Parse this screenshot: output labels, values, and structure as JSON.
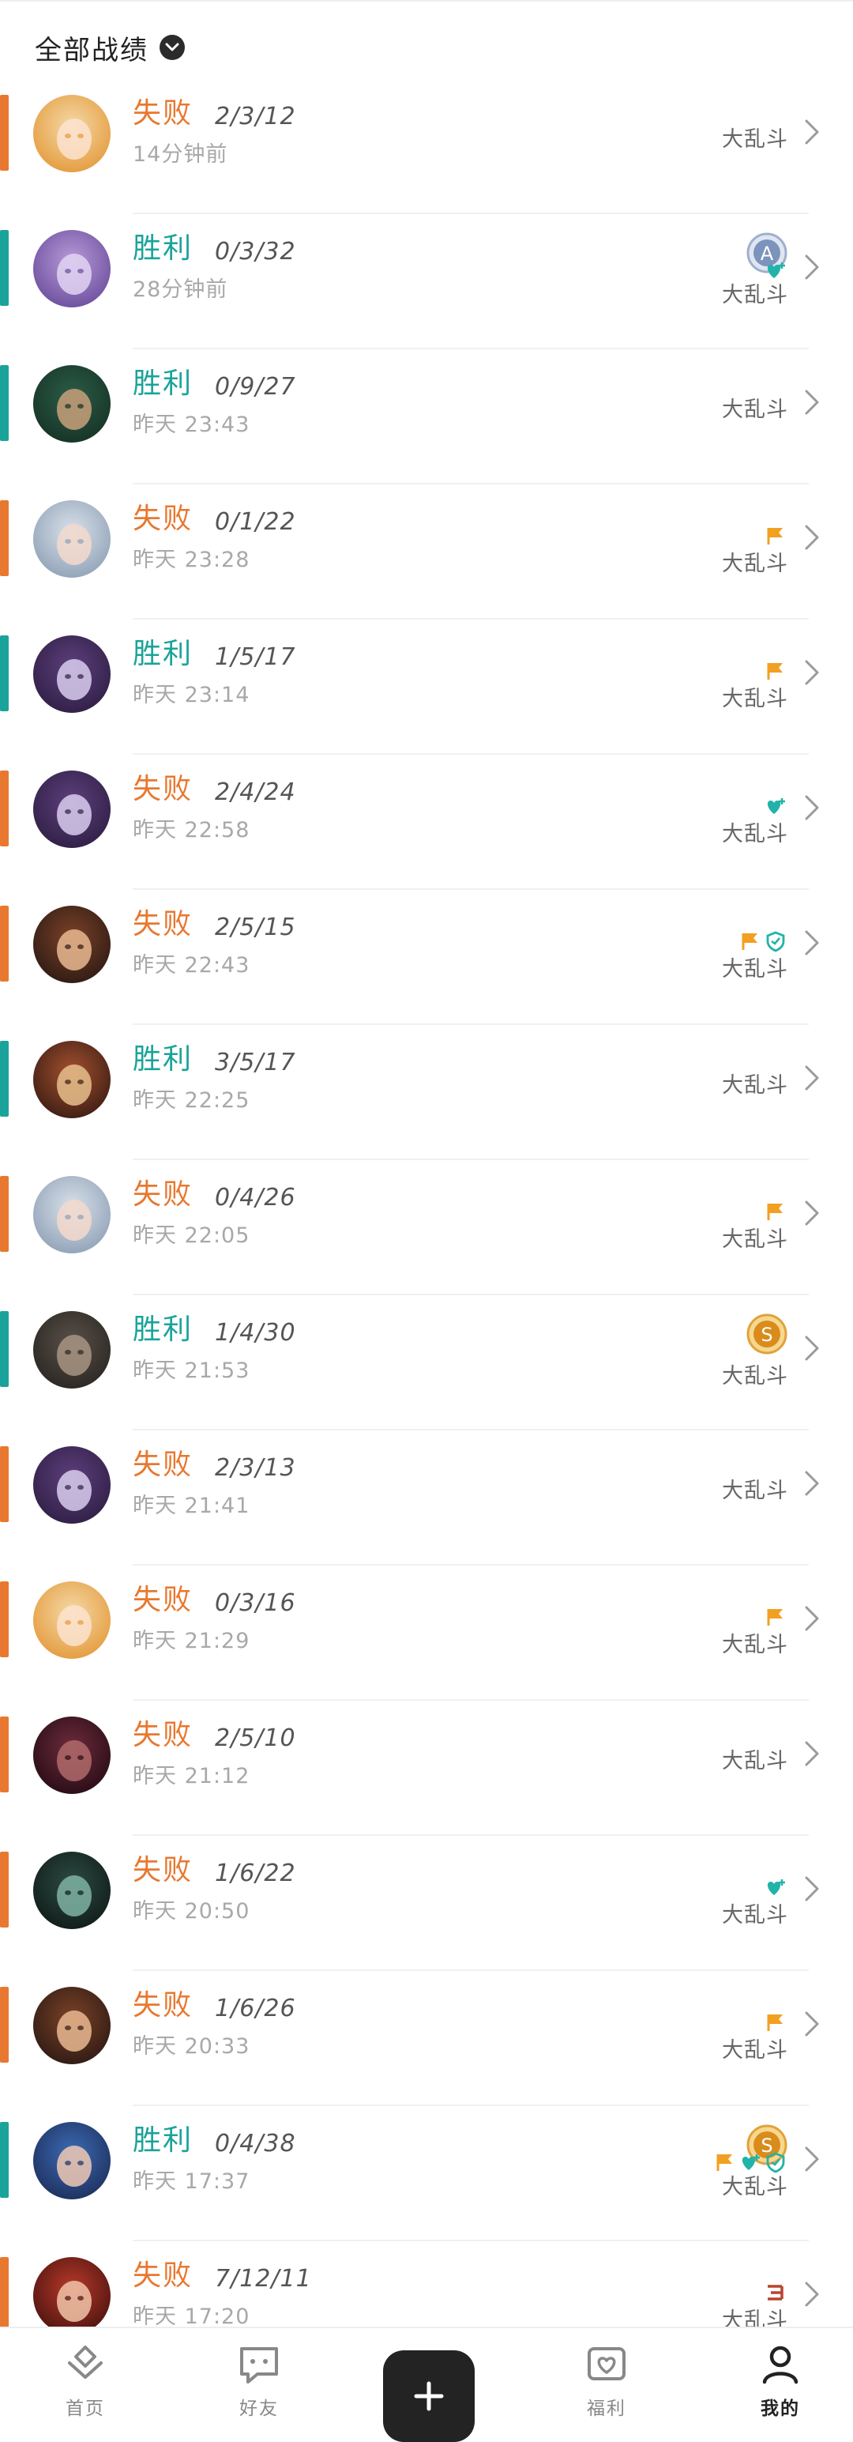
{
  "header": {
    "filter_label": "全部战绩"
  },
  "colors": {
    "win": "#1aa39a",
    "loss": "#e8782f",
    "badge_orange": "#f2a021",
    "badge_teal": "#21b3a9"
  },
  "matches": [
    {
      "result": "失败",
      "kda": "2/3/12",
      "time": "14分钟前",
      "mode": "大乱斗",
      "avatar": "blonde-champion-portrait",
      "badges": [],
      "medal": null
    },
    {
      "result": "胜利",
      "kda": "0/3/32",
      "time": "28分钟前",
      "mode": "大乱斗",
      "avatar": "purple-champion-portrait",
      "badges": [
        "heart-plus-icon"
      ],
      "medal": "A"
    },
    {
      "result": "胜利",
      "kda": "0/9/27",
      "time": "昨天 23:43",
      "mode": "大乱斗",
      "avatar": "green-champion-portrait",
      "badges": [],
      "medal": null
    },
    {
      "result": "失败",
      "kda": "0/1/22",
      "time": "昨天 23:28",
      "mode": "大乱斗",
      "avatar": "white-hair-champion-portrait",
      "badges": [
        "flag-icon"
      ],
      "medal": null
    },
    {
      "result": "胜利",
      "kda": "1/5/17",
      "time": "昨天 23:14",
      "mode": "大乱斗",
      "avatar": "yuumi-portrait",
      "badges": [
        "flag-icon"
      ],
      "medal": null
    },
    {
      "result": "失败",
      "kda": "2/4/24",
      "time": "昨天 22:58",
      "mode": "大乱斗",
      "avatar": "yuumi-portrait",
      "badges": [
        "heart-plus-icon"
      ],
      "medal": null
    },
    {
      "result": "失败",
      "kda": "2/5/15",
      "time": "昨天 22:43",
      "mode": "大乱斗",
      "avatar": "brunette-champion-portrait",
      "badges": [
        "flag-icon",
        "shield-icon"
      ],
      "medal": null
    },
    {
      "result": "胜利",
      "kda": "3/5/17",
      "time": "昨天 22:25",
      "mode": "大乱斗",
      "avatar": "teemo-portrait",
      "badges": [],
      "medal": null
    },
    {
      "result": "失败",
      "kda": "0/4/26",
      "time": "昨天 22:05",
      "mode": "大乱斗",
      "avatar": "white-hair-champion-portrait",
      "badges": [
        "flag-icon"
      ],
      "medal": null
    },
    {
      "result": "胜利",
      "kda": "1/4/30",
      "time": "昨天 21:53",
      "mode": "大乱斗",
      "avatar": "hooded-champion-portrait",
      "badges": [],
      "medal": "S"
    },
    {
      "result": "失败",
      "kda": "2/3/13",
      "time": "昨天 21:41",
      "mode": "大乱斗",
      "avatar": "yuumi-portrait",
      "badges": [],
      "medal": null
    },
    {
      "result": "失败",
      "kda": "0/3/16",
      "time": "昨天 21:29",
      "mode": "大乱斗",
      "avatar": "blonde-champion-portrait",
      "badges": [
        "flag-icon"
      ],
      "medal": null
    },
    {
      "result": "失败",
      "kda": "2/5/10",
      "time": "昨天 21:12",
      "mode": "大乱斗",
      "avatar": "dark-red-champion-portrait",
      "badges": [],
      "medal": null
    },
    {
      "result": "失败",
      "kda": "1/6/22",
      "time": "昨天 20:50",
      "mode": "大乱斗",
      "avatar": "masked-champion-portrait",
      "badges": [
        "heart-plus-icon"
      ],
      "medal": null
    },
    {
      "result": "失败",
      "kda": "1/6/26",
      "time": "昨天 20:33",
      "mode": "大乱斗",
      "avatar": "brunette-champion-portrait",
      "badges": [
        "flag-icon"
      ],
      "medal": null
    },
    {
      "result": "胜利",
      "kda": "0/4/38",
      "time": "昨天 17:37",
      "mode": "大乱斗",
      "avatar": "blue-hair-champion-portrait",
      "badges": [
        "flag-icon",
        "heart-plus-icon",
        "shield-icon"
      ],
      "medal": "S"
    },
    {
      "result": "失败",
      "kda": "7/12/11",
      "time": "昨天 17:20",
      "mode": "大乱斗",
      "avatar": "red-hair-champion-portrait",
      "badges": [
        "triple-icon"
      ],
      "medal": null
    }
  ],
  "tabbar": {
    "home": "首页",
    "friends": "好友",
    "welfare": "福利",
    "me": "我的"
  }
}
